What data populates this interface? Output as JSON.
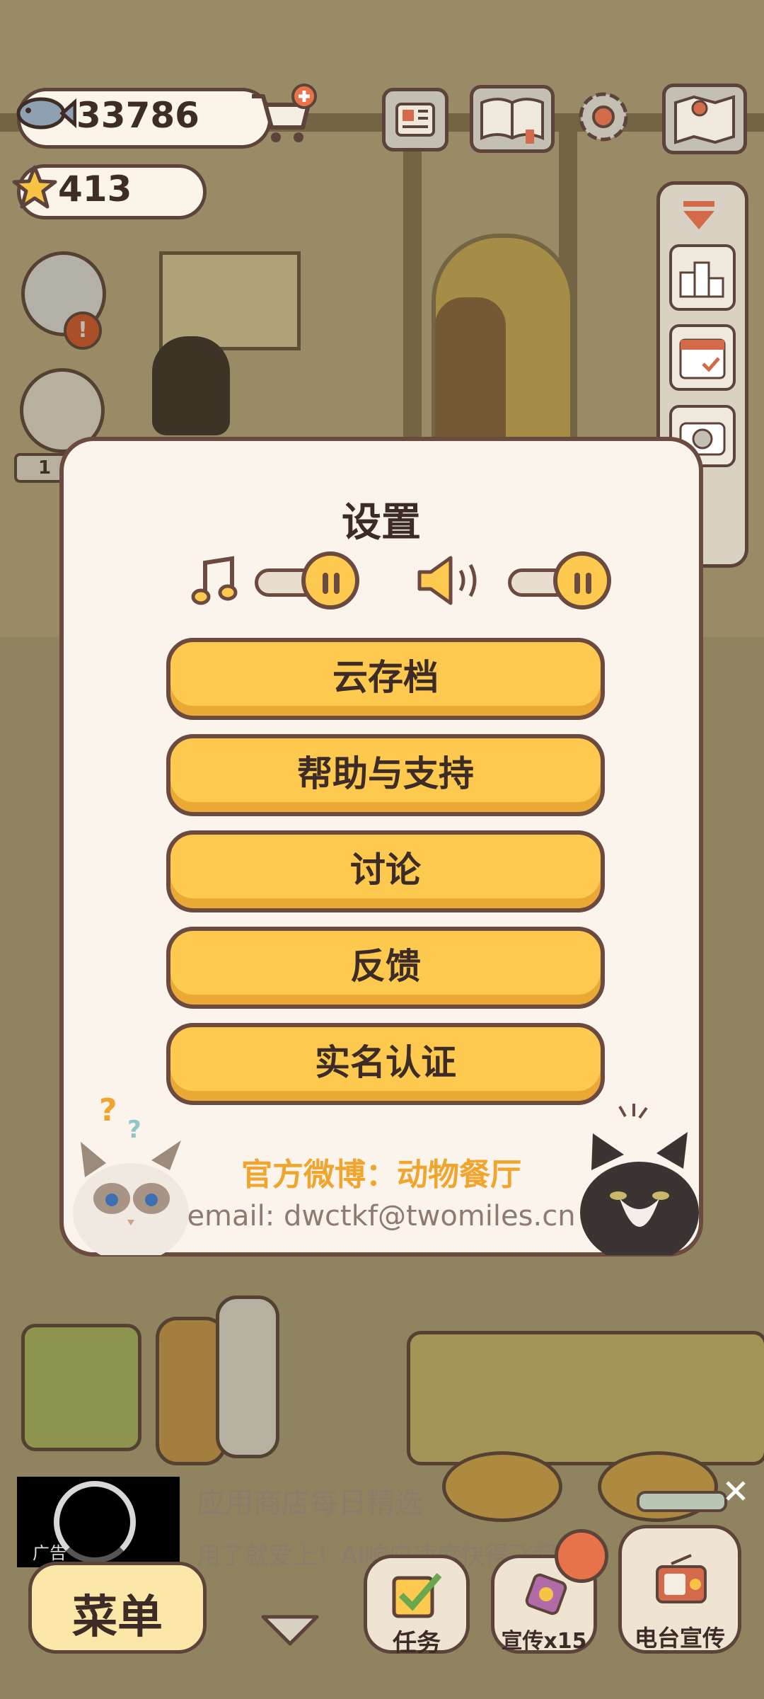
{
  "hud": {
    "fish_count": "33786",
    "star_count": "413"
  },
  "side_badge_count": "1",
  "dialog": {
    "title": "设置",
    "buttons": [
      "云存档",
      "帮助与支持",
      "讨论",
      "反馈",
      "实名认证"
    ],
    "weibo": "官方微博：动物餐厅",
    "email": "email: dwctkf@twomiles.cn",
    "music_volume": 1.0,
    "sound_volume": 1.0
  },
  "bottom_bar": {
    "menu_label": "菜单",
    "task_label": "任务",
    "promo_label": "宣传x15",
    "radio_label": "电台宣传"
  },
  "ad": {
    "title": "应用商店每日精选",
    "subtitle": "用了就爱上！AI响应速度快得飞起~",
    "badge": "广告"
  },
  "colors": {
    "accent_yellow": "#fdca4f",
    "dialog_border": "#6b4a40",
    "weibo_orange": "#f0a62e"
  }
}
